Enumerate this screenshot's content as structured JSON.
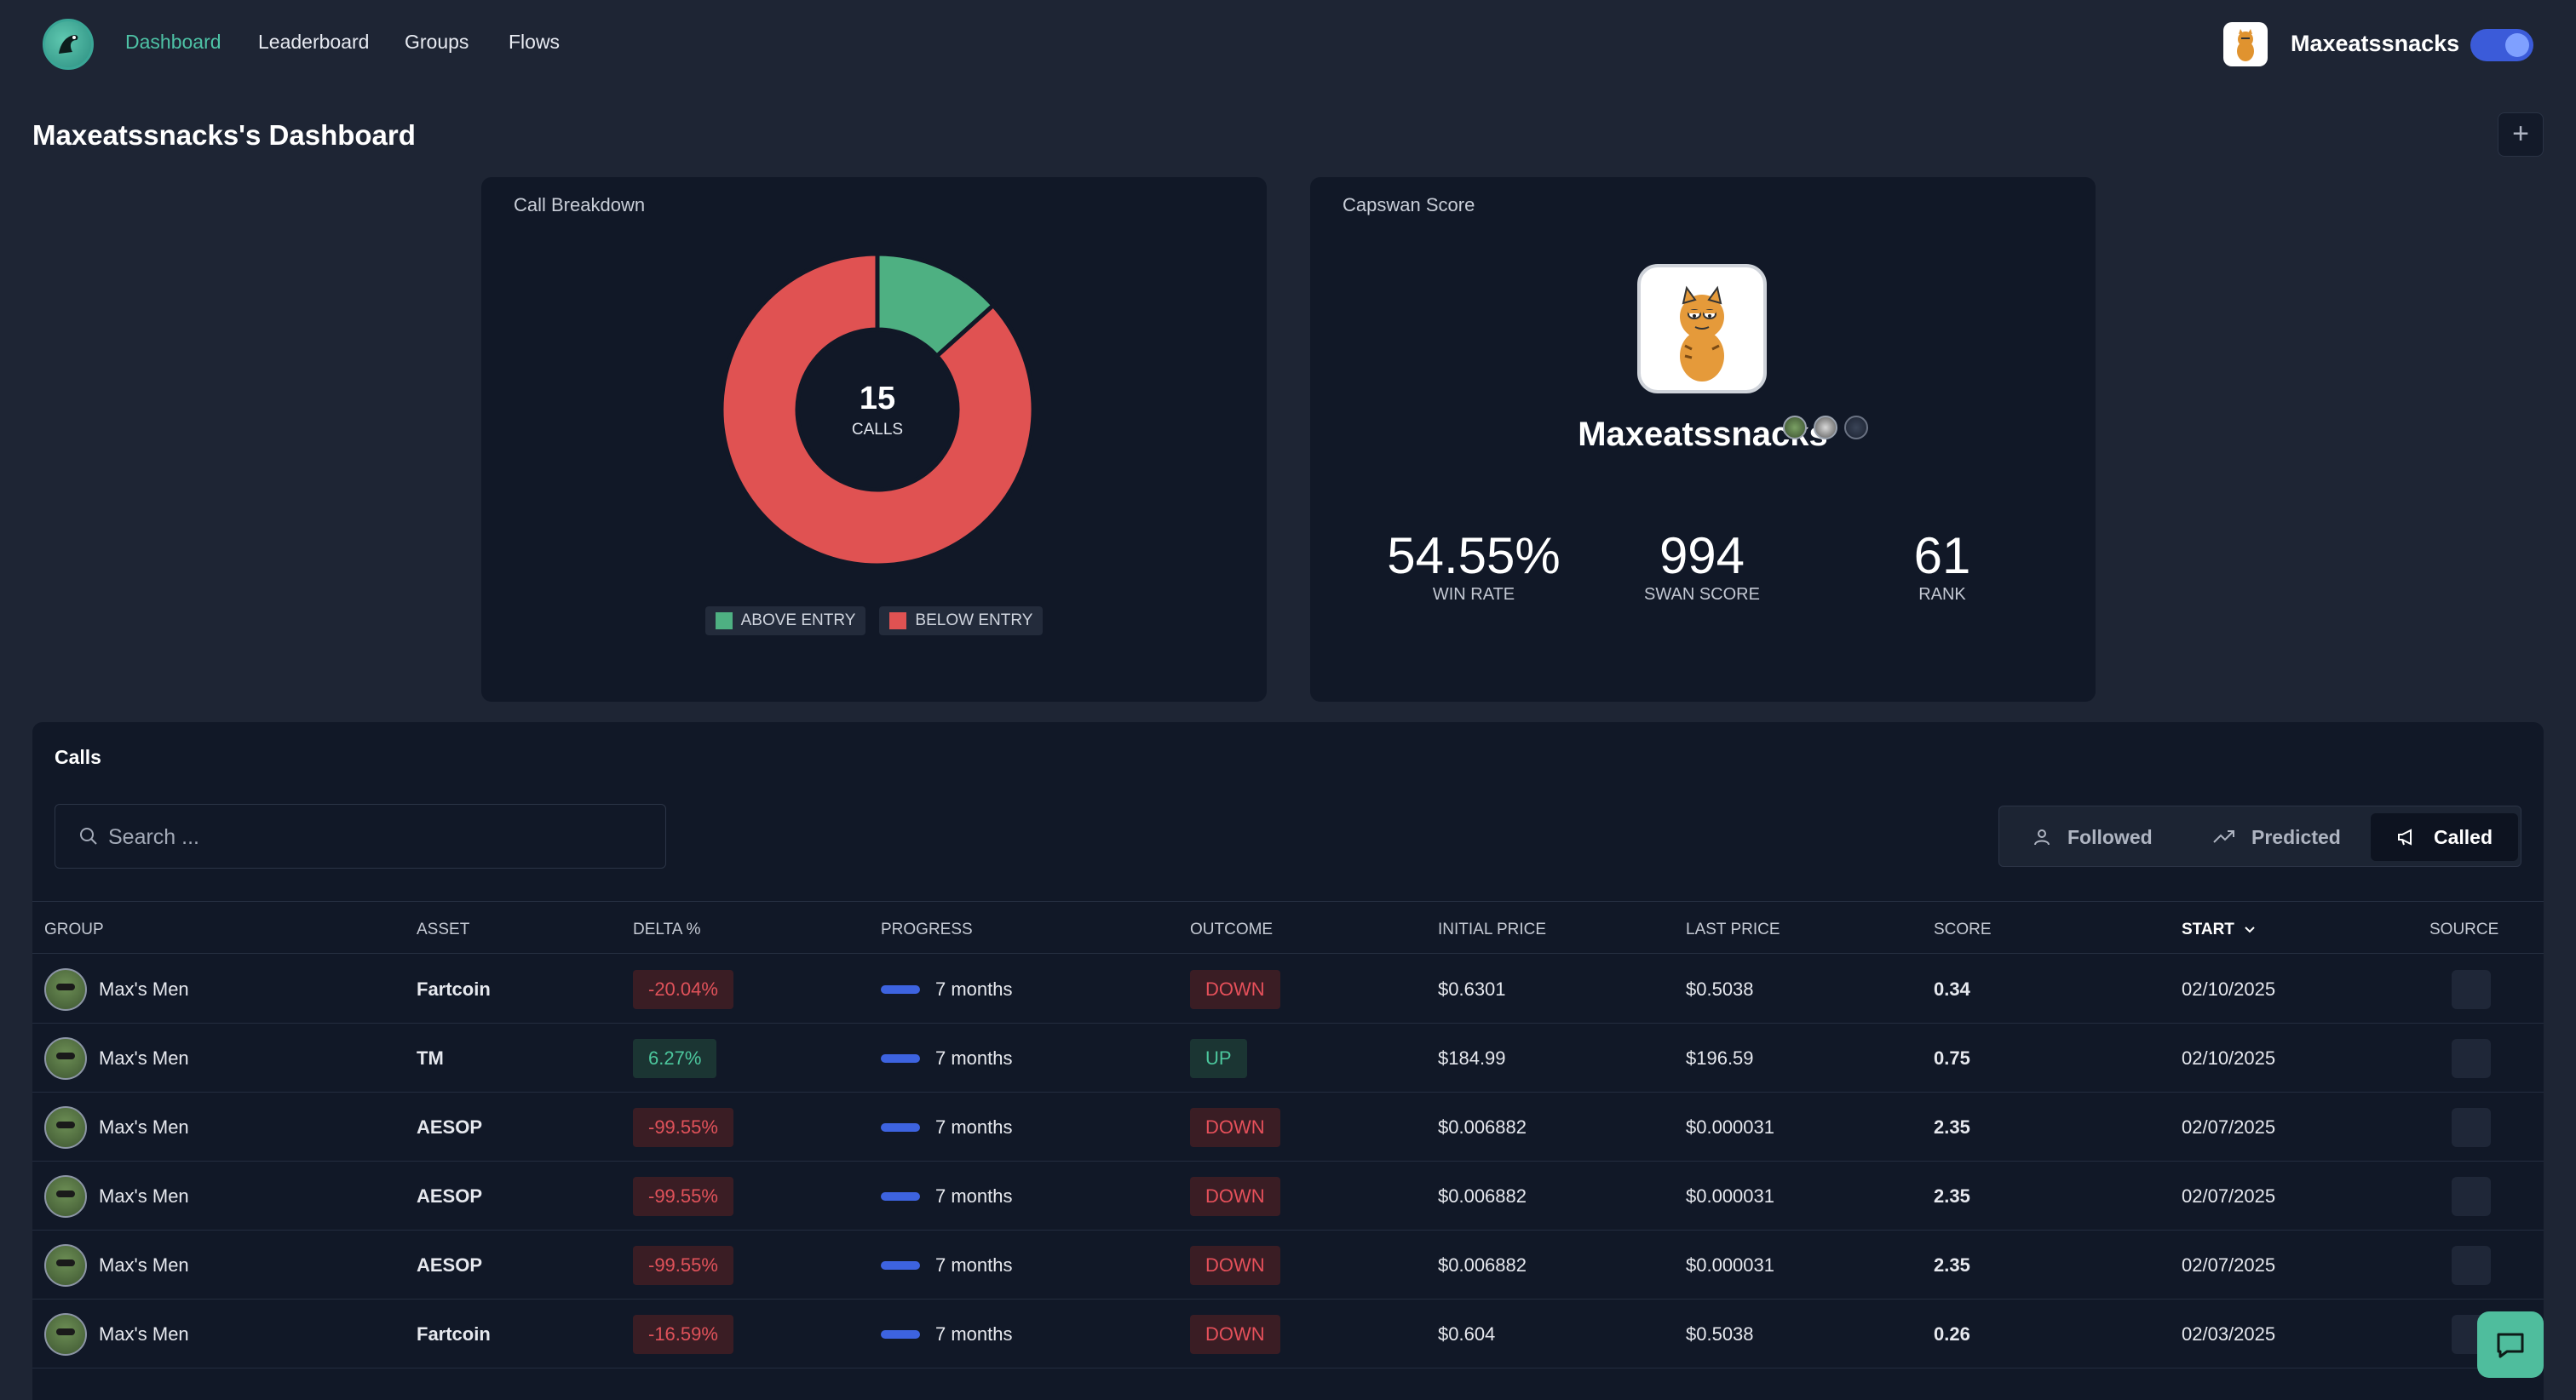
{
  "nav": {
    "links": [
      "Dashboard",
      "Leaderboard",
      "Groups",
      "Flows"
    ],
    "active": "Dashboard",
    "username": "Maxeatssnacks"
  },
  "page": {
    "title": "Maxeatssnacks's Dashboard",
    "add_label": "+"
  },
  "call_breakdown": {
    "title": "Call Breakdown",
    "total": "15",
    "total_label": "CALLS",
    "legend": [
      "ABOVE ENTRY",
      "BELOW ENTRY"
    ],
    "colors": {
      "above": "#4eb082",
      "below": "#e05252"
    }
  },
  "chart_data": {
    "type": "pie",
    "categories": [
      "ABOVE ENTRY",
      "BELOW ENTRY"
    ],
    "values": [
      2,
      13
    ]
  },
  "capswan": {
    "title": "Capswan Score",
    "name": "Maxeatssnacks",
    "stats": [
      {
        "value": "54.55%",
        "label": "WIN RATE"
      },
      {
        "value": "994",
        "label": "SWAN SCORE"
      },
      {
        "value": "61",
        "label": "RANK"
      }
    ]
  },
  "calls": {
    "title": "Calls",
    "search_placeholder": "Search ...",
    "filters": [
      "Followed",
      "Predicted",
      "Called"
    ],
    "active_filter": "Called",
    "columns": [
      "GROUP",
      "ASSET",
      "DELTA %",
      "PROGRESS",
      "OUTCOME",
      "INITIAL PRICE",
      "LAST PRICE",
      "SCORE",
      "START",
      "SOURCE"
    ],
    "sorted_column": "START",
    "rows": [
      {
        "group": "Max's Men",
        "asset": "Fartcoin",
        "delta": "-20.04%",
        "delta_sign": "neg",
        "progress": "7 months",
        "outcome": "DOWN",
        "initial": "$0.6301",
        "last": "$0.5038",
        "score": "0.34",
        "start": "02/10/2025"
      },
      {
        "group": "Max's Men",
        "asset": "TM",
        "delta": "6.27%",
        "delta_sign": "pos",
        "progress": "7 months",
        "outcome": "UP",
        "initial": "$184.99",
        "last": "$196.59",
        "score": "0.75",
        "start": "02/10/2025"
      },
      {
        "group": "Max's Men",
        "asset": "AESOP",
        "delta": "-99.55%",
        "delta_sign": "neg",
        "progress": "7 months",
        "outcome": "DOWN",
        "initial": "$0.006882",
        "last": "$0.000031",
        "score": "2.35",
        "start": "02/07/2025"
      },
      {
        "group": "Max's Men",
        "asset": "AESOP",
        "delta": "-99.55%",
        "delta_sign": "neg",
        "progress": "7 months",
        "outcome": "DOWN",
        "initial": "$0.006882",
        "last": "$0.000031",
        "score": "2.35",
        "start": "02/07/2025"
      },
      {
        "group": "Max's Men",
        "asset": "AESOP",
        "delta": "-99.55%",
        "delta_sign": "neg",
        "progress": "7 months",
        "outcome": "DOWN",
        "initial": "$0.006882",
        "last": "$0.000031",
        "score": "2.35",
        "start": "02/07/2025"
      },
      {
        "group": "Max's Men",
        "asset": "Fartcoin",
        "delta": "-16.59%",
        "delta_sign": "neg",
        "progress": "7 months",
        "outcome": "DOWN",
        "initial": "$0.604",
        "last": "$0.5038",
        "score": "0.26",
        "start": "02/03/2025"
      }
    ]
  }
}
